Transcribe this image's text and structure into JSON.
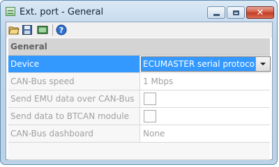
{
  "window": {
    "title": "Ext. port - General",
    "min_label": "",
    "max_label": "",
    "close_label": "✕"
  },
  "toolbar": {
    "icons": [
      "open-folder-icon",
      "save-icon",
      "view-icon",
      "help-icon"
    ]
  },
  "grid": {
    "section": "General",
    "rows": [
      {
        "name": "Device",
        "value": "ECUMASTER serial protocol",
        "type": "dropdown",
        "selected": true
      },
      {
        "name": "CAN-Bus speed",
        "value": "1 Mbps",
        "type": "text"
      },
      {
        "name": "Send EMU data over CAN-Bus",
        "value": "",
        "type": "checkbox",
        "checked": false
      },
      {
        "name": "Send data to BTCAN module",
        "value": "",
        "type": "checkbox",
        "checked": false
      },
      {
        "name": "CAN-Bus dashboard",
        "value": "None",
        "type": "text"
      }
    ]
  },
  "colors": {
    "selection": "#3399ff",
    "section_bg": "#d4d4d4",
    "disabled_text": "#a0a0a0",
    "close_button": "#c33c25"
  }
}
